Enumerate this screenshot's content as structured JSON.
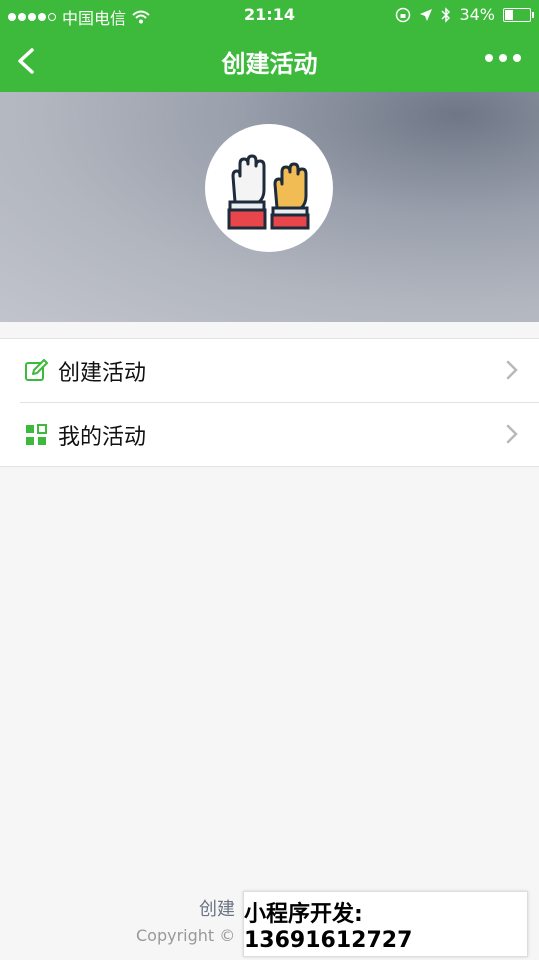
{
  "status_bar": {
    "carrier": "中国电信",
    "time": "21:14",
    "battery": "34%"
  },
  "nav": {
    "title": "创建活动"
  },
  "menu": {
    "items": [
      {
        "label": "创建活动",
        "icon": "edit-icon"
      },
      {
        "label": "我的活动",
        "icon": "grid-icon"
      }
    ]
  },
  "footer": {
    "line1": "创建",
    "line2": "Copyright ©"
  },
  "ad": {
    "text": "小程序开发: 13691612727"
  },
  "colors": {
    "brand_green": "#3dba3c"
  }
}
